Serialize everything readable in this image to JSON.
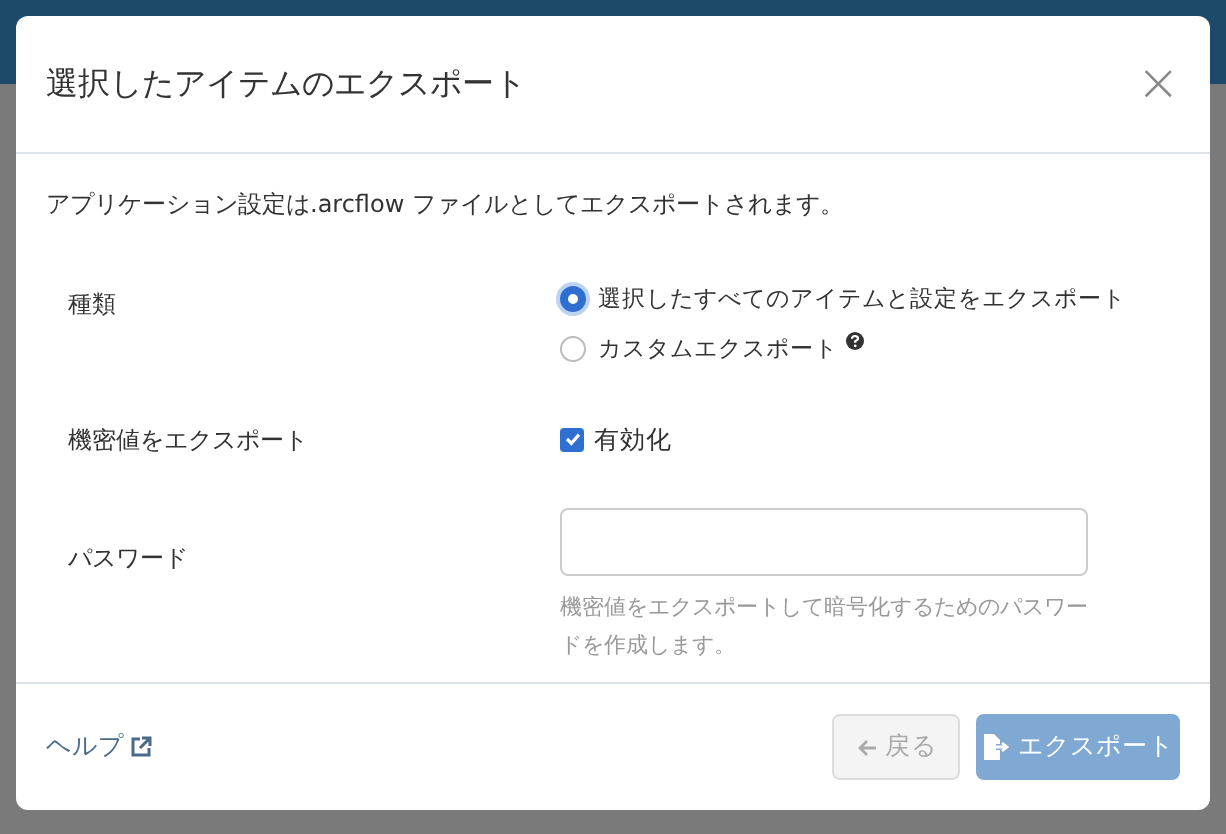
{
  "dialog": {
    "title": "選択したアイテムのエクスポート",
    "close": "×",
    "description": "アプリケーション設定は.arcflow ファイルとしてエクスポートされます。",
    "type": {
      "label": "種類",
      "options": [
        {
          "label": "選択したすべてのアイテムと設定をエクスポート",
          "selected": true,
          "help": false
        },
        {
          "label": "カスタムエクスポート",
          "selected": false,
          "help": true
        }
      ]
    },
    "secrets": {
      "label": "機密値をエクスポート",
      "checkbox": {
        "label": "有効化",
        "checked": true
      }
    },
    "password": {
      "label": "パスワード",
      "hint": "機密値をエクスポートして暗号化するためのパスワードを作成します。"
    },
    "footer": {
      "help_link": "ヘルプ",
      "buttons": [
        {
          "kind": "back",
          "label": "戻る",
          "disabled": true
        },
        {
          "kind": "export",
          "label": "エクスポート",
          "disabled": true
        }
      ]
    }
  }
}
